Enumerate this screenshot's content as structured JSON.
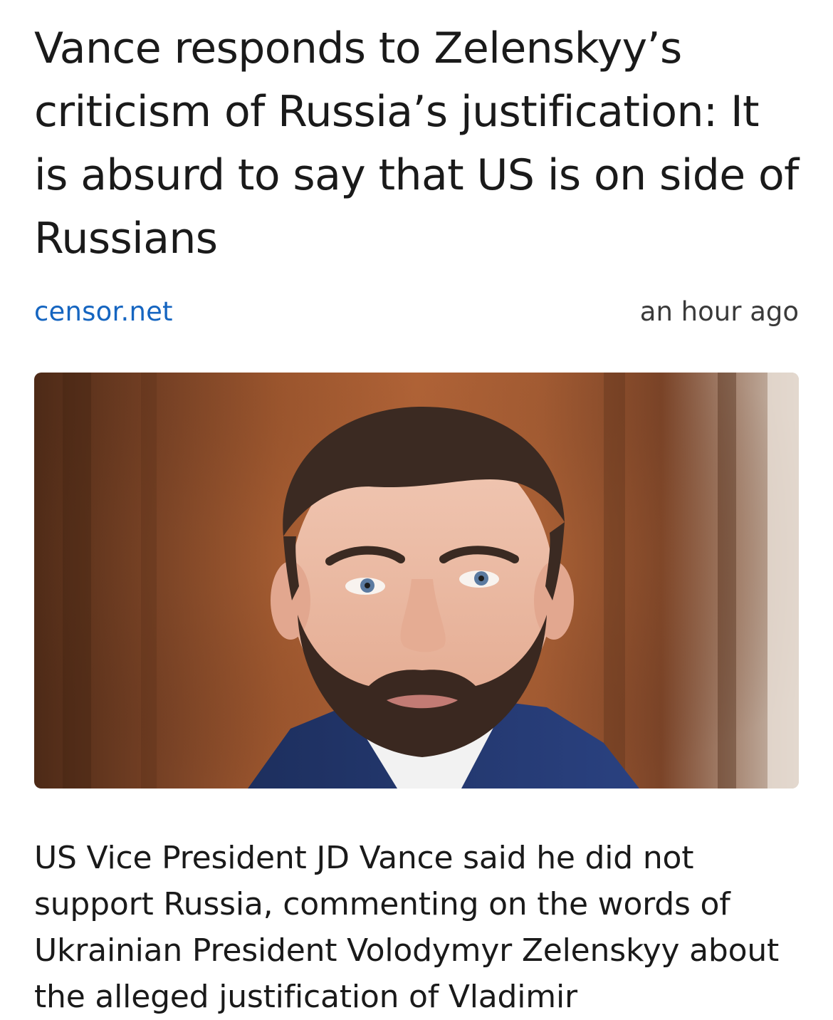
{
  "article": {
    "headline": "Vance responds to Zelenskyy’s criticism of Russia’s justification: It is absurd to say that US is on side of Russians",
    "source": "censor.net",
    "time": "an hour ago",
    "photo_subject": "man-portrait",
    "body": "US Vice President JD Vance said he did not support Russia, commenting on the words of Ukrainian President Volodymyr Zelenskyy about the alleged justification of Vladimir"
  },
  "colors": {
    "source_link": "#1565c0",
    "text": "#1a1a1a",
    "background": "#ffffff"
  }
}
